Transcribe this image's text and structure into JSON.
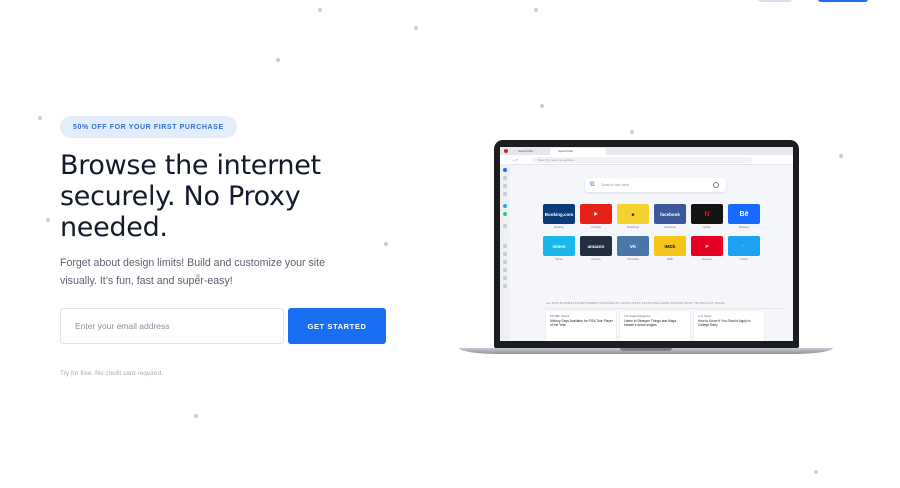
{
  "hero": {
    "badge": "50% OFF FOR YOUR FIRST PURCHASE",
    "headline": "Browse the internet securely. No Proxy needed.",
    "subtext": "Forget about design limits! Build and customize your site visually. It’s fun, fast and super-easy!",
    "email_placeholder": "Enter your email address",
    "cta_label": "GET STARTED",
    "note": "Try for free. No credit card required."
  },
  "colors": {
    "accent": "#1a6ef2",
    "badge_bg": "#e3ecfb",
    "badge_text": "#2f6fd6",
    "headline": "#141a2b",
    "laptop_frame": "#1c1d20"
  },
  "browser": {
    "tabs": [
      "Speed Dial",
      "Speed Dial"
    ],
    "address_placeholder": "Search or enter an address",
    "search_logo": "G",
    "search_placeholder": "Search the web",
    "tiles_row1": [
      {
        "name": "Booking.com",
        "label": "Booking",
        "color": "#0b3a7a"
      },
      {
        "name": "▶",
        "label": "YouTube",
        "color": "#e62117"
      },
      {
        "name": "☻",
        "label": "Mailchimp",
        "color": "#f6d22f"
      },
      {
        "name": "facebook",
        "label": "Facebook",
        "color": "#3b5998"
      },
      {
        "name": "N",
        "label": "Netflix",
        "color": "#141414"
      },
      {
        "name": "Bē",
        "label": "Behance",
        "color": "#1769ff"
      }
    ],
    "tiles_row2": [
      {
        "name": "vimeo",
        "label": "Vimeo",
        "color": "#19b7ea"
      },
      {
        "name": "amazon",
        "label": "Amazon",
        "color": "#232f3e"
      },
      {
        "name": "VK",
        "label": "VKontakte",
        "color": "#4a76a8"
      },
      {
        "name": "IMDb",
        "label": "IMDb",
        "color": "#f5c518"
      },
      {
        "name": "P",
        "label": "Pinterest",
        "color": "#e60023"
      },
      {
        "name": "🐦",
        "label": "Twitter",
        "color": "#1da1f2"
      }
    ],
    "news_tabs": "ALL   ARTS   BUSINESS   ENTERTAINMENT   FOOD   HEALTH   LIVING   LIFESTYLE   NATIONAL   NEWS   SCIENCE   SPORT   TECHNOLOGY   TRAVEL",
    "news_cards": [
      {
        "source": "PS NBC Sports",
        "title": "McIlroy Says Available for PGA Tour Player of the Year"
      },
      {
        "source": "The Faded Magazine",
        "title": "Listen to Stranger Things star Maya Hawke's debut singles"
      },
      {
        "source": "U.S. News",
        "title": "How to Know If You Should Apply to College Early"
      }
    ]
  }
}
